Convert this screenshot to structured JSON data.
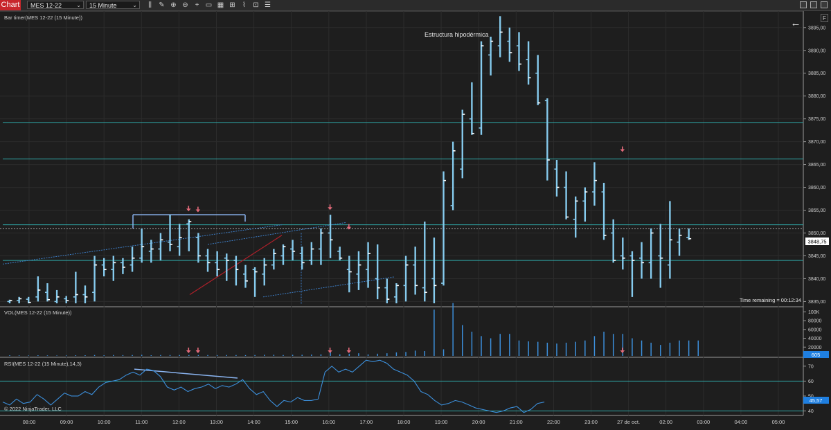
{
  "toolbar": {
    "tab_label": "Chart",
    "instrument": "MES 12-22",
    "interval": "15 Minute",
    "icons": [
      "bar-type-icon",
      "pencil-icon",
      "zoom-in-icon",
      "zoom-out-icon",
      "crosshair-icon",
      "document-icon",
      "properties-icon",
      "global-crosshair-icon",
      "strategy-icon",
      "indicator-icon",
      "list-icon"
    ]
  },
  "window_buttons": [
    "minimize-icon",
    "restore-icon",
    "close-icon"
  ],
  "f_button": "F",
  "back_arrow": "←",
  "price_panel": {
    "title": "Bar timer(MES 12-22 (15 Minute))",
    "annotation": "Estructura hipodérmica",
    "time_remaining": "Time remaining = 00:12:34",
    "current_price": "3848,75",
    "ticks": [
      "3895,00",
      "3890,00",
      "3885,00",
      "3880,00",
      "3875,00",
      "3870,00",
      "3865,00",
      "3860,00",
      "3855,00",
      "3850,00",
      "3845,00",
      "3840,00",
      "3835,00"
    ],
    "colors": {
      "bar": "#86cbee",
      "hline": "#2fa8a8",
      "price_box": "#ffffff"
    }
  },
  "vol_panel": {
    "title": "VOL(MES 12-22 (15 Minute))",
    "ticks": [
      "100K",
      "80000",
      "60000",
      "40000",
      "20000"
    ],
    "current_value": "605",
    "colors": {
      "bar": "#3c8fdb",
      "badge": "#1f7fe0"
    }
  },
  "rsi_panel": {
    "title": "RSI(MES 12-22 (15 Minute),14,3)",
    "ticks": [
      "70",
      "60",
      "50",
      "40"
    ],
    "current_value": "45,57",
    "copyright": "© 2022 NinjaTrader, LLC",
    "colors": {
      "line": "#3c8fdb",
      "level": "#2fa8a8",
      "badge": "#1f7fe0"
    }
  },
  "time_axis": [
    "08:00",
    "09:00",
    "10:00",
    "11:00",
    "12:00",
    "13:00",
    "14:00",
    "15:00",
    "16:00",
    "17:00",
    "18:00",
    "19:00",
    "20:00",
    "21:00",
    "22:00",
    "23:00",
    "27 de oct.",
    "02:00",
    "03:00",
    "04:00",
    "05:00"
  ],
  "chart_data": {
    "type": "ohlc",
    "interval": "15 Minute",
    "start_time": "07:30",
    "price_ylim": [
      3834,
      3898
    ],
    "horizontal_levels": [
      3874.2,
      3866.2,
      3851.8,
      3844.0
    ],
    "current_price_level": 3850.9,
    "bars": [
      {
        "o": 3835.0,
        "h": 3835.4,
        "l": 3834.6,
        "c": 3835.2
      },
      {
        "o": 3835.2,
        "h": 3836.0,
        "l": 3834.6,
        "c": 3835.6
      },
      {
        "o": 3835.5,
        "h": 3836.0,
        "l": 3834.6,
        "c": 3834.8
      },
      {
        "o": 3836.0,
        "h": 3840.5,
        "l": 3835.0,
        "c": 3837.5
      },
      {
        "o": 3837.0,
        "h": 3839.0,
        "l": 3835.0,
        "c": 3835.4
      },
      {
        "o": 3835.0,
        "h": 3837.5,
        "l": 3834.6,
        "c": 3836.0
      },
      {
        "o": 3835.6,
        "h": 3836.2,
        "l": 3834.6,
        "c": 3835.2
      },
      {
        "o": 3836.0,
        "h": 3841.5,
        "l": 3834.6,
        "c": 3836.5
      },
      {
        "o": 3836.5,
        "h": 3838.5,
        "l": 3834.6,
        "c": 3836.0
      },
      {
        "o": 3837.0,
        "h": 3845.0,
        "l": 3835.0,
        "c": 3843.0
      },
      {
        "o": 3843.0,
        "h": 3844.5,
        "l": 3840.5,
        "c": 3842.0
      },
      {
        "o": 3842.0,
        "h": 3845.0,
        "l": 3839.5,
        "c": 3843.5
      },
      {
        "o": 3843.5,
        "h": 3844.5,
        "l": 3841.0,
        "c": 3842.5
      },
      {
        "o": 3843.0,
        "h": 3847.0,
        "l": 3841.5,
        "c": 3844.5
      },
      {
        "o": 3844.5,
        "h": 3851.0,
        "l": 3843.5,
        "c": 3847.0
      },
      {
        "o": 3846.0,
        "h": 3848.5,
        "l": 3843.5,
        "c": 3846.5
      },
      {
        "o": 3846.5,
        "h": 3850.0,
        "l": 3844.0,
        "c": 3848.5
      },
      {
        "o": 3848.0,
        "h": 3854.0,
        "l": 3846.0,
        "c": 3847.5
      },
      {
        "o": 3847.0,
        "h": 3852.0,
        "l": 3845.0,
        "c": 3849.0
      },
      {
        "o": 3852.0,
        "h": 3853.0,
        "l": 3846.0,
        "c": 3852.5
      },
      {
        "o": 3849.0,
        "h": 3850.0,
        "l": 3843.5,
        "c": 3845.0
      },
      {
        "o": 3845.0,
        "h": 3846.5,
        "l": 3841.5,
        "c": 3843.5
      },
      {
        "o": 3843.5,
        "h": 3846.0,
        "l": 3840.5,
        "c": 3842.0
      },
      {
        "o": 3844.5,
        "h": 3845.5,
        "l": 3839.5,
        "c": 3844.0
      },
      {
        "o": 3844.0,
        "h": 3845.0,
        "l": 3838.5,
        "c": 3842.0
      },
      {
        "o": 3841.0,
        "h": 3843.0,
        "l": 3838.0,
        "c": 3839.5
      },
      {
        "o": 3842.0,
        "h": 3842.5,
        "l": 3836.0,
        "c": 3841.5
      },
      {
        "o": 3841.0,
        "h": 3844.5,
        "l": 3838.5,
        "c": 3843.0
      },
      {
        "o": 3843.0,
        "h": 3846.5,
        "l": 3842.0,
        "c": 3845.5
      },
      {
        "o": 3845.0,
        "h": 3847.5,
        "l": 3843.0,
        "c": 3847.0
      },
      {
        "o": 3846.5,
        "h": 3848.5,
        "l": 3844.0,
        "c": 3846.0
      },
      {
        "o": 3845.5,
        "h": 3847.0,
        "l": 3842.0,
        "c": 3843.5
      },
      {
        "o": 3844.0,
        "h": 3848.0,
        "l": 3843.0,
        "c": 3846.5
      },
      {
        "o": 3846.5,
        "h": 3851.0,
        "l": 3843.0,
        "c": 3850.0
      },
      {
        "o": 3850.0,
        "h": 3854.0,
        "l": 3844.5,
        "c": 3848.5
      },
      {
        "o": 3846.0,
        "h": 3847.0,
        "l": 3844.0,
        "c": 3844.5
      },
      {
        "o": 3842.0,
        "h": 3845.0,
        "l": 3837.0,
        "c": 3841.5
      },
      {
        "o": 3841.0,
        "h": 3846.0,
        "l": 3837.5,
        "c": 3843.0
      },
      {
        "o": 3842.0,
        "h": 3848.0,
        "l": 3838.0,
        "c": 3845.5
      },
      {
        "o": 3840.0,
        "h": 3847.5,
        "l": 3835.5,
        "c": 3838.0
      },
      {
        "o": 3838.0,
        "h": 3840.0,
        "l": 3834.6,
        "c": 3835.5
      },
      {
        "o": 3836.0,
        "h": 3839.0,
        "l": 3834.6,
        "c": 3838.5
      },
      {
        "o": 3838.5,
        "h": 3845.0,
        "l": 3835.0,
        "c": 3843.0
      },
      {
        "o": 3843.0,
        "h": 3847.0,
        "l": 3836.5,
        "c": 3838.5
      },
      {
        "o": 3838.0,
        "h": 3852.5,
        "l": 3835.0,
        "c": 3837.0
      },
      {
        "o": 3840.0,
        "h": 3849.0,
        "l": 3834.6,
        "c": 3838.5
      },
      {
        "o": 3839.0,
        "h": 3863.5,
        "l": 3838.5,
        "c": 3861.5
      },
      {
        "o": 3856.0,
        "h": 3870.0,
        "l": 3855.0,
        "c": 3868.0
      },
      {
        "o": 3864.0,
        "h": 3877.0,
        "l": 3862.0,
        "c": 3876.0
      },
      {
        "o": 3875.0,
        "h": 3883.0,
        "l": 3871.5,
        "c": 3871.8
      },
      {
        "o": 3873.0,
        "h": 3892.0,
        "l": 3871.5,
        "c": 3891.0
      },
      {
        "o": 3889.0,
        "h": 3893.0,
        "l": 3884.5,
        "c": 3892.0
      },
      {
        "o": 3891.0,
        "h": 3897.5,
        "l": 3888.5,
        "c": 3894.0
      },
      {
        "o": 3892.0,
        "h": 3895.0,
        "l": 3887.5,
        "c": 3889.5
      },
      {
        "o": 3891.0,
        "h": 3894.0,
        "l": 3885.5,
        "c": 3887.0
      },
      {
        "o": 3888.0,
        "h": 3892.0,
        "l": 3882.5,
        "c": 3884.0
      },
      {
        "o": 3885.0,
        "h": 3889.0,
        "l": 3878.0,
        "c": 3878.5
      },
      {
        "o": 3879.0,
        "h": 3879.5,
        "l": 3861.5,
        "c": 3866.0
      },
      {
        "o": 3864.0,
        "h": 3866.0,
        "l": 3858.0,
        "c": 3860.0
      },
      {
        "o": 3860.0,
        "h": 3863.5,
        "l": 3853.0,
        "c": 3853.5
      },
      {
        "o": 3853.0,
        "h": 3858.0,
        "l": 3849.0,
        "c": 3857.0
      },
      {
        "o": 3857.0,
        "h": 3860.0,
        "l": 3852.5,
        "c": 3859.0
      },
      {
        "o": 3859.0,
        "h": 3865.5,
        "l": 3856.0,
        "c": 3861.5
      },
      {
        "o": 3859.0,
        "h": 3861.0,
        "l": 3848.5,
        "c": 3849.5
      },
      {
        "o": 3850.0,
        "h": 3853.0,
        "l": 3843.5,
        "c": 3844.0
      },
      {
        "o": 3845.0,
        "h": 3849.0,
        "l": 3842.0,
        "c": 3844.5
      },
      {
        "o": 3845.0,
        "h": 3846.0,
        "l": 3836.0,
        "c": 3844.0
      },
      {
        "o": 3844.5,
        "h": 3848.0,
        "l": 3840.0,
        "c": 3843.5
      },
      {
        "o": 3843.5,
        "h": 3851.0,
        "l": 3840.0,
        "c": 3850.0
      },
      {
        "o": 3845.0,
        "h": 3852.0,
        "l": 3838.0,
        "c": 3844.5
      },
      {
        "o": 3843.0,
        "h": 3857.0,
        "l": 3840.0,
        "c": 3848.5
      },
      {
        "o": 3848.0,
        "h": 3851.0,
        "l": 3845.0,
        "c": 3849.5
      },
      {
        "o": 3849.0,
        "h": 3851.0,
        "l": 3848.5,
        "c": 3848.75
      }
    ],
    "volume": {
      "ylim": [
        0,
        110000
      ],
      "values": [
        1500,
        1200,
        1000,
        1500,
        1200,
        1000,
        1200,
        1500,
        1500,
        2000,
        1500,
        2000,
        1800,
        2000,
        2500,
        1500,
        2000,
        2000,
        2000,
        2000,
        2000,
        2000,
        1800,
        2000,
        2000,
        1800,
        2000,
        2500,
        2500,
        2000,
        2500,
        2500,
        3000,
        3500,
        10000,
        3500,
        5000,
        6000,
        3500,
        5000,
        6000,
        8000,
        9000,
        12000,
        11000,
        105000,
        15000,
        120000,
        70000,
        55000,
        45000,
        40000,
        50000,
        50000,
        35000,
        33000,
        32000,
        30000,
        28000,
        30000,
        32000,
        35000,
        45000,
        55000,
        50000,
        50000,
        40000,
        35000,
        30000,
        25000,
        30000,
        35000,
        35000,
        35000
      ]
    },
    "rsi": {
      "ylim": [
        37,
        75
      ],
      "levels": [
        60,
        40
      ],
      "values": [
        46,
        44,
        48,
        45,
        46,
        51,
        48,
        44,
        48,
        52,
        50,
        50,
        53,
        51,
        56,
        59,
        60,
        61,
        64,
        66,
        64,
        68,
        67,
        63,
        56,
        54,
        56,
        53,
        55,
        56,
        58,
        55,
        57,
        56,
        58,
        61,
        55,
        51,
        53,
        47,
        43,
        47,
        46,
        49,
        47,
        47,
        48,
        66,
        70,
        66,
        68,
        66,
        70,
        74,
        73,
        74,
        72,
        68,
        66,
        64,
        60,
        53,
        51,
        47,
        44,
        45,
        47,
        46,
        44,
        42,
        41,
        40,
        39,
        40,
        42,
        43,
        39,
        41,
        45,
        46
      ]
    },
    "arrows_price": [
      {
        "bar": 19,
        "price": 3855.5
      },
      {
        "bar": 20,
        "price": 3855.3
      },
      {
        "bar": 34,
        "price": 3855.8
      },
      {
        "bar": 36,
        "price": 3851.5
      },
      {
        "bar": 65,
        "price": 3868.5
      }
    ],
    "arrows_volume": [
      19,
      20,
      34,
      36,
      65
    ]
  }
}
